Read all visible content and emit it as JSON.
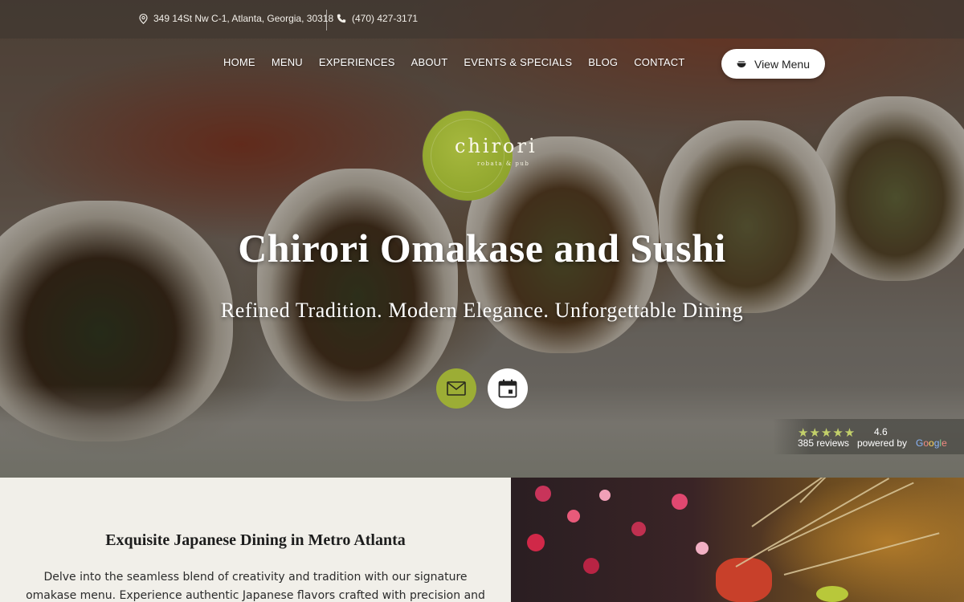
{
  "topbar": {
    "address": "349 14St Nw C-1, Atlanta, Georgia, 30318",
    "phone": "(470) 427-3171"
  },
  "nav": {
    "items": [
      "HOME",
      "MENU",
      "EXPERIENCES",
      "ABOUT",
      "EVENTS & SPECIALS",
      "BLOG",
      "CONTACT"
    ],
    "view_menu_label": "View Menu"
  },
  "logo": {
    "word": "chirori",
    "subtitle": "robata & pub"
  },
  "hero": {
    "title": "Chirori Omakase and Sushi",
    "subtitle": "Refined Tradition. Modern Elegance. Unforgettable Dining"
  },
  "rating": {
    "stars": "★★★★★",
    "value": "4.6",
    "reviews": "385 reviews",
    "powered_by": "powered by",
    "provider": "Google"
  },
  "intro": {
    "title": "Exquisite Japanese Dining in Metro Atlanta",
    "body": "Delve into the seamless blend of creativity and tradition with our signature omakase menu. Experience authentic Japanese flavors crafted with precision and seasonal"
  },
  "colors": {
    "accent": "#9cad35",
    "logo_green": "#93a82f",
    "section_bg": "#f1efe9"
  },
  "icons": [
    "location-pin-icon",
    "phone-icon",
    "bowl-icon",
    "mail-icon",
    "calendar-icon",
    "star-icon"
  ]
}
